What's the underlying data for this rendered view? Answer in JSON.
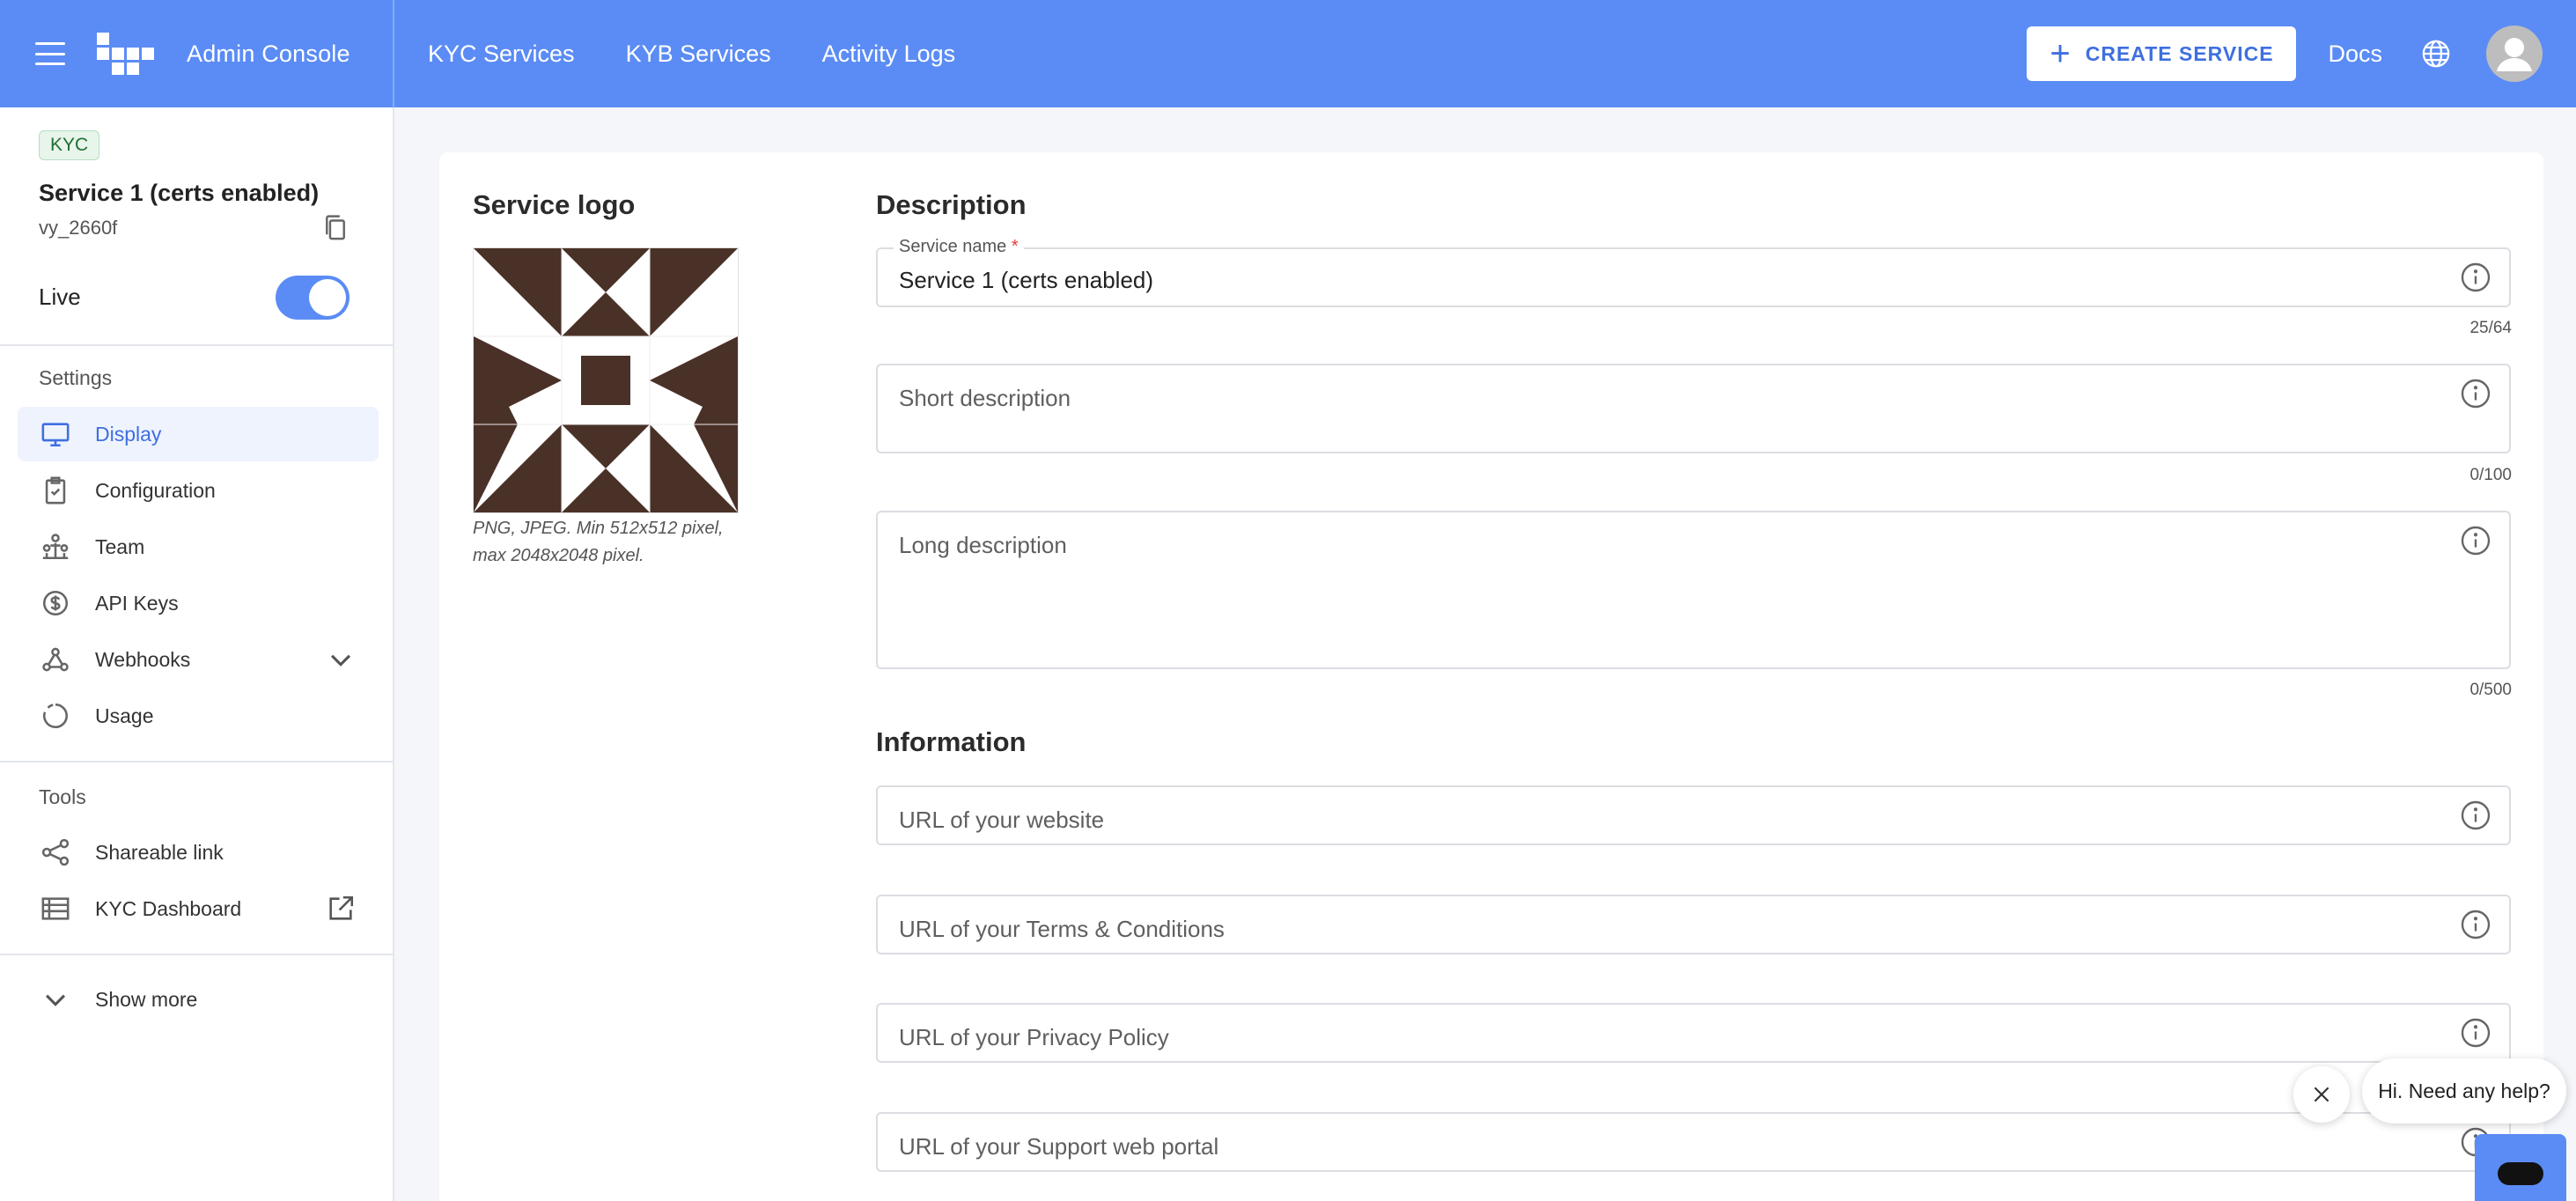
{
  "header": {
    "app_title": "Admin Console",
    "nav": [
      "KYC Services",
      "KYB Services",
      "Activity Logs"
    ],
    "create_label": "CREATE SERVICE",
    "docs_label": "Docs",
    "brand_color": "#5b8cf5"
  },
  "sidebar": {
    "badge": "KYC",
    "service_title": "Service 1 (certs enabled)",
    "service_id": "vy_2660f",
    "live_label": "Live",
    "live_on": true,
    "settings_label": "Settings",
    "settings_items": [
      {
        "label": "Display",
        "icon": "monitor-icon",
        "active": true
      },
      {
        "label": "Configuration",
        "icon": "clipboard-icon"
      },
      {
        "label": "Team",
        "icon": "team-icon"
      },
      {
        "label": "API Keys",
        "icon": "dollar-circle-icon"
      },
      {
        "label": "Webhooks",
        "icon": "webhook-icon"
      },
      {
        "label": "Usage",
        "icon": "circle-progress-icon"
      }
    ],
    "tools_label": "Tools",
    "tools_items": [
      {
        "label": "Shareable link",
        "icon": "share-icon"
      },
      {
        "label": "KYC Dashboard",
        "icon": "list-icon"
      }
    ],
    "show_more_label": "Show more"
  },
  "main": {
    "logo_section_title": "Service logo",
    "logo_hint": "PNG, JPEG. Min 512x512 pixel, max 2048x2048 pixel.",
    "description_title": "Description",
    "service_name_label": "Service name",
    "service_name_required": "*",
    "service_name_value": "Service 1 (certs enabled)",
    "service_name_counter": "25/64",
    "short_desc_placeholder": "Short description",
    "short_desc_counter": "0/100",
    "long_desc_placeholder": "Long description",
    "long_desc_counter": "0/500",
    "information_title": "Information",
    "url_website_placeholder": "URL of your website",
    "url_terms_placeholder": "URL of your Terms & Conditions",
    "url_privacy_placeholder": "URL of your Privacy Policy",
    "url_support_placeholder": "URL of your Support web portal"
  },
  "chat": {
    "bubble_text": "Hi. Need any help?"
  }
}
